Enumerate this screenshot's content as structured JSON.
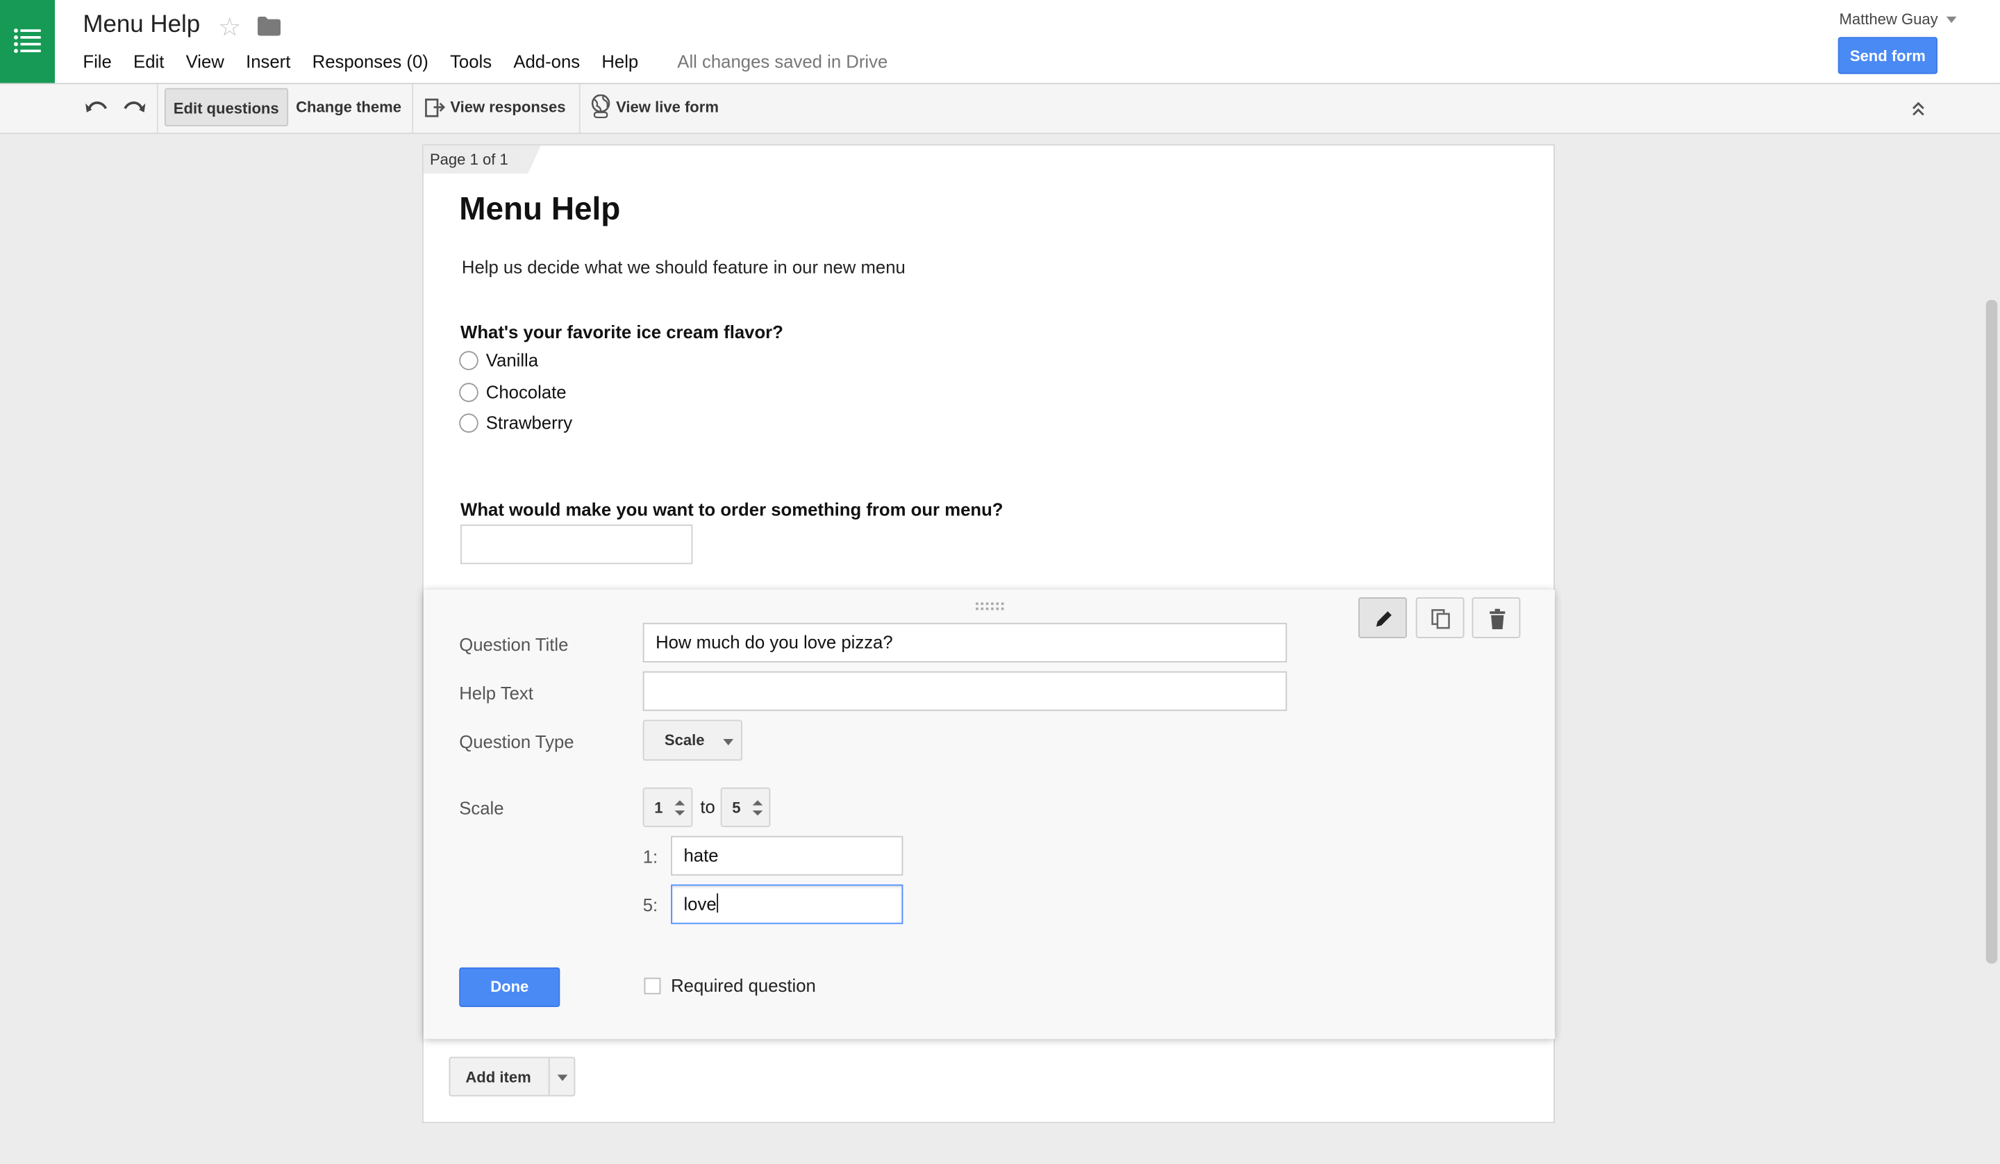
{
  "header": {
    "doc_title": "Menu Help",
    "menu": [
      "File",
      "Edit",
      "View",
      "Insert",
      "Responses (0)",
      "Tools",
      "Add-ons",
      "Help"
    ],
    "save_status": "All changes saved in Drive",
    "user_name": "Matthew Guay",
    "send_label": "Send form"
  },
  "toolbar": {
    "edit_questions": "Edit questions",
    "change_theme": "Change theme",
    "view_responses": "View responses",
    "view_live_form": "View live form"
  },
  "form": {
    "page_indicator": "Page 1 of 1",
    "title": "Menu Help",
    "description": "Help us decide what we should feature in our new menu",
    "q1": {
      "title": "What's your favorite ice cream flavor?",
      "options": [
        "Vanilla",
        "Chocolate",
        "Strawberry"
      ]
    },
    "q2": {
      "title": "What would make you want to order something from our menu?"
    }
  },
  "editor": {
    "question_title_label": "Question Title",
    "question_title_value": "How much do you love pizza?",
    "help_text_label": "Help Text",
    "help_text_value": "",
    "question_type_label": "Question Type",
    "question_type_value": "Scale",
    "scale_label": "Scale",
    "scale_from": "1",
    "scale_to": "5",
    "to_label": "to",
    "low_label_num": "1:",
    "low_label_value": "hate",
    "high_label_num": "5:",
    "high_label_value": "love",
    "done_label": "Done",
    "required_label": "Required question",
    "required_checked": false
  },
  "add_item_label": "Add item",
  "colors": {
    "brand_green": "#169a55",
    "primary_blue": "#4a8af4",
    "focus_blue": "#4d90fe"
  }
}
